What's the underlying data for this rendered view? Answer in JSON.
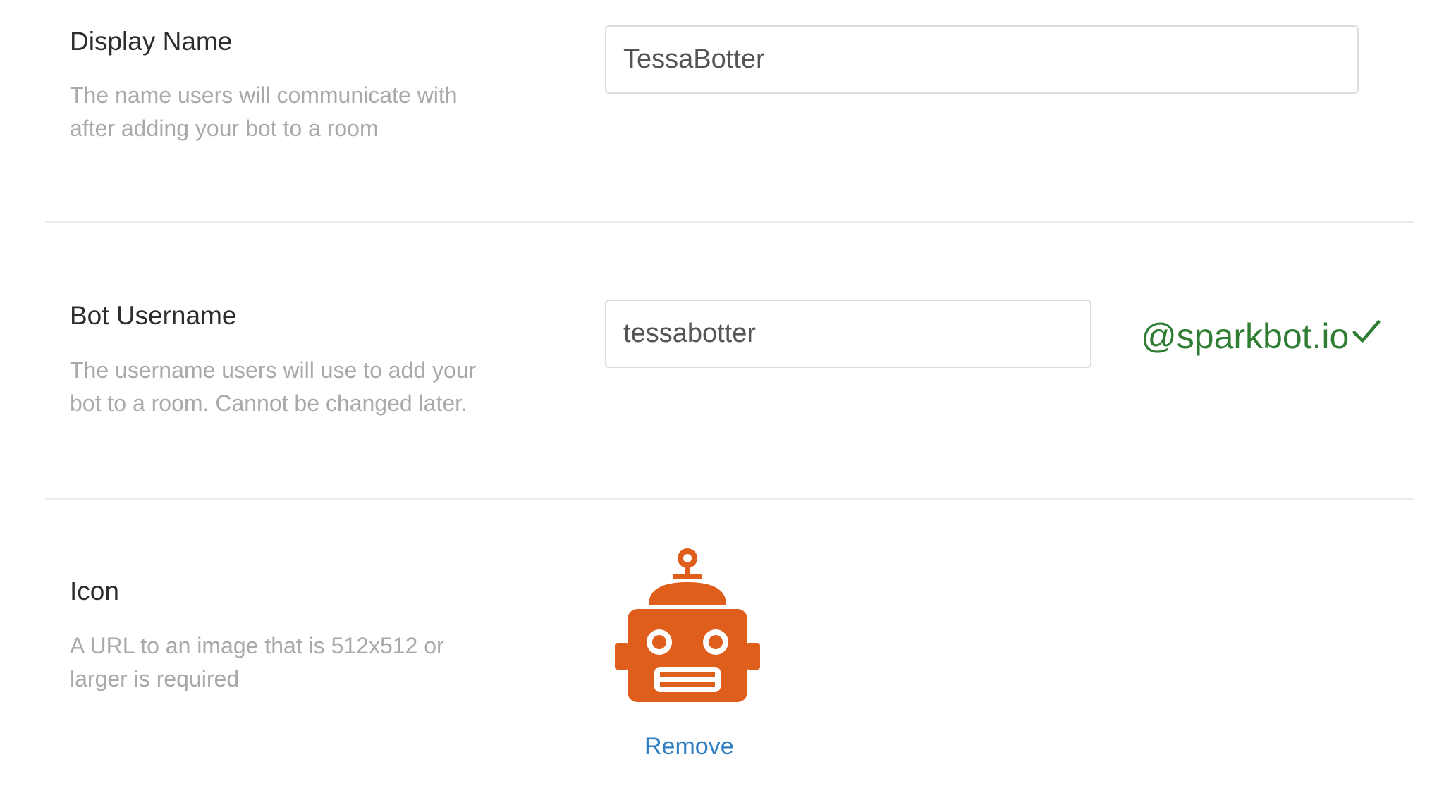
{
  "display_name": {
    "label": "Display Name",
    "description_line1": "The name users will communicate with",
    "description_line2": "after adding your bot to a room",
    "value": "TessaBotter"
  },
  "bot_username": {
    "label": "Bot Username",
    "description_line1": "The username users will use to add your",
    "description_line2": "bot to a room. Cannot be changed later.",
    "value": "tessabotter",
    "domain_suffix": "@sparkbot.io",
    "status_icon": "check-icon",
    "status_color": "#2e7d32"
  },
  "icon_section": {
    "label": "Icon",
    "description_line1": "A URL to an image that is 512x512 or",
    "description_line2": "larger is required",
    "image_icon": "robot-icon",
    "image_color": "#e05e1b",
    "remove_label": "Remove"
  }
}
